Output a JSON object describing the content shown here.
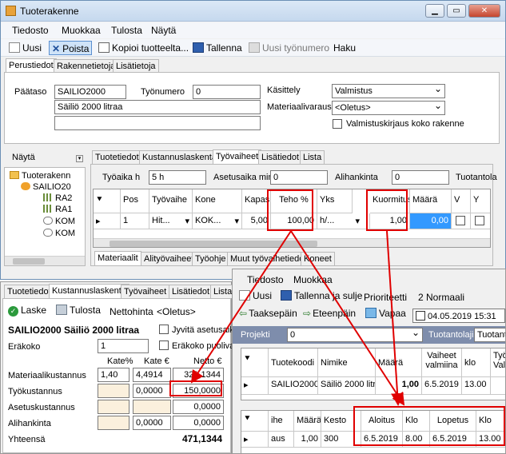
{
  "window": {
    "title": "Tuoterakenne",
    "controls": [
      "▁",
      "▭",
      "✕"
    ]
  },
  "menu": [
    "Tiedosto",
    "Muokkaa",
    "Tulosta",
    "Näytä"
  ],
  "toolbar": {
    "new": "Uusi",
    "delete": "Poista",
    "copy": "Kopioi tuotteelta...",
    "save": "Tallenna",
    "new_work": "Uusi työnumero",
    "search": "Haku"
  },
  "top_tabs": [
    "Perustiedot",
    "Rakennetietoja",
    "Lisätietoja"
  ],
  "basic": {
    "paataso_label": "Päätaso",
    "paataso": "SAILIO2000",
    "tyonumero_label": "Työnumero",
    "tyonumero": "0",
    "description": "Säiliö 2000 litraa",
    "kasittely_label": "Käsittely",
    "kasittely": "Valmistus",
    "materiaali_label": "Materiaalivaraus",
    "materiaali": "<Oletus>",
    "valmistuskirjaus_label": "Valmistuskirjaus koko rakenne"
  },
  "tree": {
    "header": "Näytä",
    "nodes": [
      "Tuoterakenn",
      "SAILIO20",
      "RA2",
      "RA1",
      "KOM",
      "KOM"
    ]
  },
  "detail_tabs": [
    "Tuotetiedot",
    "Kustannuslaskenta",
    "Työvaiheet",
    "Lisätiedot",
    "Lista"
  ],
  "work": {
    "tyoaika_label": "Työaika h",
    "tyoaika": "5 h",
    "asetusaika_label": "Asetusaika min",
    "asetusaika": "0",
    "alihankinta_label": "Alihankinta",
    "alihankinta": "0",
    "tuotantolaji_label": "Tuotantola"
  },
  "work_grid": {
    "headers": [
      "Pos",
      "Työvaihe",
      "Kone",
      "Kapasit",
      "Teho %",
      "Yks",
      "Kuormitus",
      "Määrä",
      "V",
      "Y"
    ],
    "row": {
      "pos": "1",
      "tyovaihe": "Hit...",
      "kone": "KOK...",
      "kapasit": "5,00",
      "teho": "100,00",
      "yks": "h/...",
      "kuormitus": "1,00",
      "maara": "0,00"
    }
  },
  "bottom_tabs": [
    "Materiaalit",
    "Alityövaiheet",
    "Työohje",
    "Muut työvaihetiedot",
    "Koneet"
  ],
  "cost": {
    "tabs": [
      "Tuotetiedot",
      "Kustannuslaskenta",
      "Työvaiheet",
      "Lisätiedot",
      "Lista"
    ],
    "toolbar": {
      "calc": "Laske",
      "print": "Tulosta",
      "net_label": "Nettohinta",
      "net_value": "<Oletus>"
    },
    "title": "SAILIO2000 Säiliö 2000 litraa",
    "jyvita_label": "Jyvitä asetusaika",
    "erakoko_label": "Eräkoko",
    "erakoko": "1",
    "erakoko_puolival_label": "Eräkoko puolival",
    "col_headers": [
      "Kate%",
      "Kate €",
      "Netto €"
    ],
    "rows": [
      {
        "label": "Materiaalikustannus",
        "kate_pct": "1,40",
        "kate_eur": "4,4914",
        "netto": "321,1344"
      },
      {
        "label": "Työkustannus",
        "kate_pct": "",
        "kate_eur": "0,0000",
        "netto": "150,0000"
      },
      {
        "label": "Asetuskustannus",
        "kate_pct": "",
        "kate_eur": "",
        "netto": "0,0000"
      },
      {
        "label": "Alihankinta",
        "kate_pct": "",
        "kate_eur": "0,0000",
        "netto": "0,0000"
      }
    ],
    "total_label": "Yhteensä",
    "total": "471,1344"
  },
  "order": {
    "menu": [
      "Tiedosto",
      "Muokkaa"
    ],
    "toolbar": {
      "new": "Uusi",
      "save_close": "Tallenna ja sulje",
      "priority_label": "Prioriteetti",
      "priority": "2 Normaali"
    },
    "toolbar2": {
      "back": "Taaksepäin",
      "forward": "Eteenpäin",
      "release": "Vapaa",
      "datetime": "04.05.2019 15:31"
    },
    "projekti_label": "Projekti",
    "projekti": "0",
    "tuotantolaji_label": "Tuotantolaji",
    "tuotantolaji": "Tuotanto",
    "grid1_headers": [
      "Tuotekoodi",
      "Nimike",
      "Määrä",
      "Vaiheet valmiina",
      "klo",
      "Työ Valm"
    ],
    "grid1_row": {
      "koodi": "SAILIO2000",
      "nimike": "Säiliö 2000 litr...",
      "maara": "1,00",
      "vaiheet": "6.5.2019",
      "klo": "13.00",
      "tyo": ""
    },
    "grid2_headers": [
      "ihe",
      "Määrä",
      "Kesto",
      "Aloitus",
      "Klo",
      "Lopetus",
      "Klo"
    ],
    "grid2_row": {
      "ihe": "aus",
      "maara": "1,00",
      "kesto": "300",
      "aloitus": "6.5.2019",
      "klo1": "8.00",
      "lopetus": "6.5.2019",
      "klo2": "13.00"
    }
  }
}
